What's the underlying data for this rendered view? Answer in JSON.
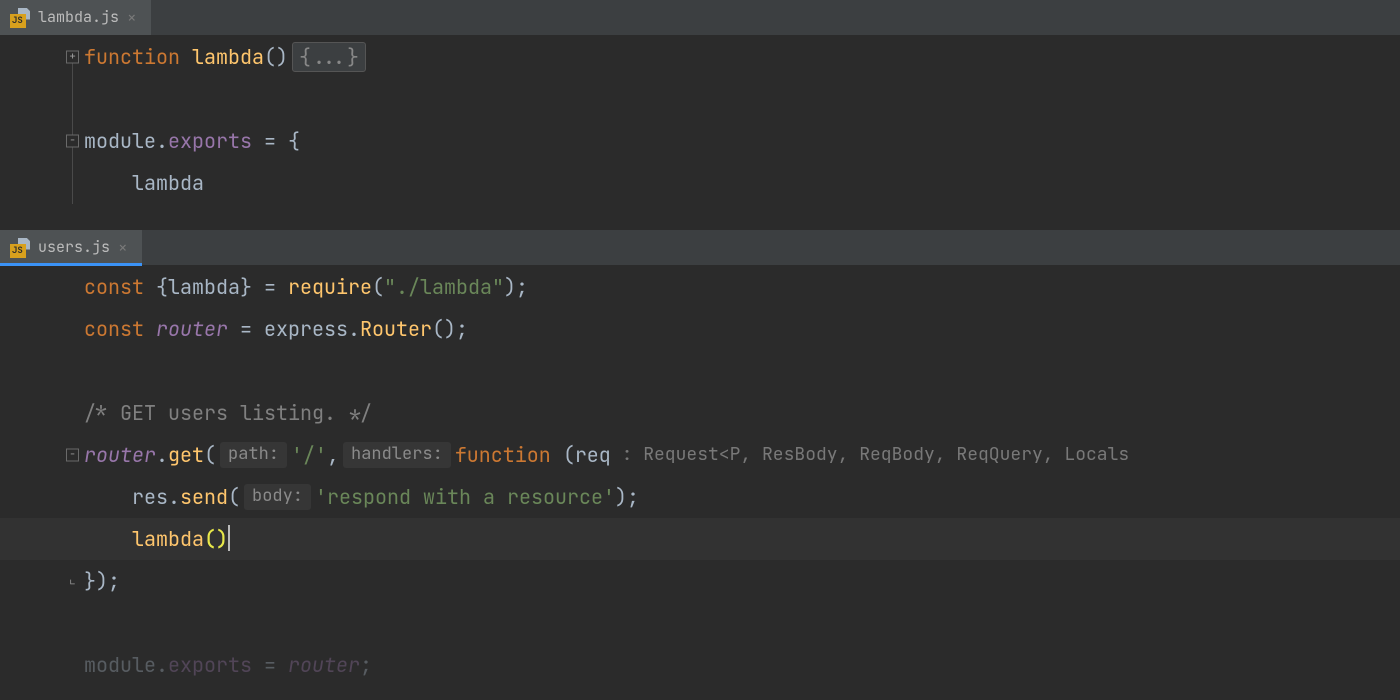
{
  "tabs": {
    "top": {
      "file": "lambda.js",
      "icon_label": "JS"
    },
    "bottom": {
      "file": "users.js",
      "icon_label": "JS"
    }
  },
  "code_top": {
    "l1": {
      "kw": "function ",
      "fn": "lambda",
      "parens": "()",
      "folded": "{...}"
    },
    "l2": "",
    "l3": {
      "a": "module",
      "dot1": ".",
      "b": "exports",
      "rest": " = {"
    },
    "l4": {
      "indent": "    ",
      "id": "lambda"
    }
  },
  "code_bottom": {
    "l1": {
      "kw": "const ",
      "brace_o": "{",
      "id": "lambda",
      "brace_c": "}",
      "eq": " = ",
      "fn": "require",
      "p_o": "(",
      "str": "\"./lambda\"",
      "p_c": ");"
    },
    "l2": {
      "kw": "const ",
      "id": "router",
      "eq": " = ",
      "obj": "express",
      "dot": ".",
      "method": "Router",
      "p": "();"
    },
    "l3": "",
    "l4": {
      "comment": "/* GET users listing. */"
    },
    "l5": {
      "obj": "router",
      "dot": ".",
      "method": "get",
      "p_o": "(",
      "hint_path_label": "path:",
      "hint_path_val": "'/'",
      "comma": ",",
      "hint_handlers_label": "handlers:",
      "fn_kw": "function ",
      "p2_o": "(",
      "arg": "req",
      "type_hint": " : Request<P, ResBody, ReqBody, ReqQuery, Locals"
    },
    "l6": {
      "indent": "    ",
      "obj": "res",
      "dot": ".",
      "method": "send",
      "p_o": "(",
      "hint_body_label": "body:",
      "str": "'respond with a resource'",
      "p_c": ");"
    },
    "l7": {
      "indent": "    ",
      "fn": "lambda",
      "p_o": "(",
      "p_c": ")"
    },
    "l8": {
      "text": "});"
    },
    "l9": "",
    "l10": {
      "a": "module",
      "dot": ".",
      "b": "exports",
      "eq": " = ",
      "id": "router",
      "semi": ";"
    }
  },
  "fold": {
    "plus": "+",
    "minus": "−",
    "corner": "⌞"
  }
}
